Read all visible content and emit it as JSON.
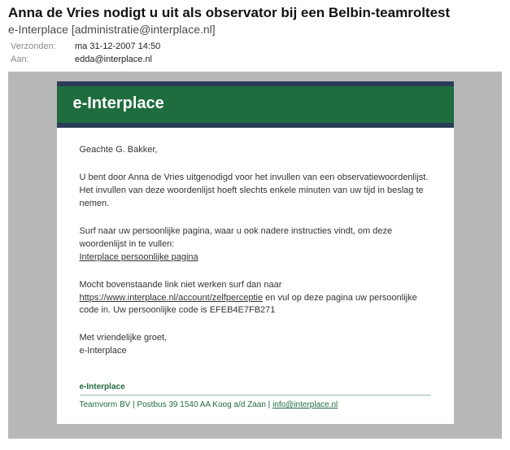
{
  "email": {
    "subject": "Anna de Vries nodigt u uit als observator bij een Belbin-teamroltest",
    "from_display": "e-Interplace [administratie@interplace.nl]",
    "meta": {
      "sent_label": "Verzonden:",
      "sent_value": "ma 31-12-2007 14:50",
      "to_label": "Aan:",
      "to_value": "edda@interplace.nl"
    }
  },
  "panel": {
    "header": "e-Interplace",
    "body": {
      "salutation": "Geachte G. Bakker,",
      "p1": "U bent door Anna de Vries uitgenodigd voor het invullen van een observatiewoordenlijst. Het invullen van deze woordenlijst hoeft slechts enkele minuten van uw tijd in beslag te nemen.",
      "p2": "Surf naar uw persoonlijke pagina, waar u ook nadere instructies vindt, om deze woordenlijst in te vullen:",
      "personal_link_text": "Interplace persoonlijke pagina",
      "p3a": "Mocht bovenstaande link niet werken surf dan naar ",
      "alt_link_text": "https://www.interplace.nl/account/zelfperceptie",
      "p3b": " en vul op deze pagina uw persoonlijke code in. Uw persoonlijke code is EFEB4E7FB271",
      "closing1": "Met vriendelijke groet,",
      "closing2": "e-Interplace"
    },
    "footer": {
      "brand": "e-Interplace",
      "line2_pre": "Teamvorm BV | Postbus 39 1540 AA Koog a/d Zaan | ",
      "mail": "info@interplace.nl"
    }
  }
}
